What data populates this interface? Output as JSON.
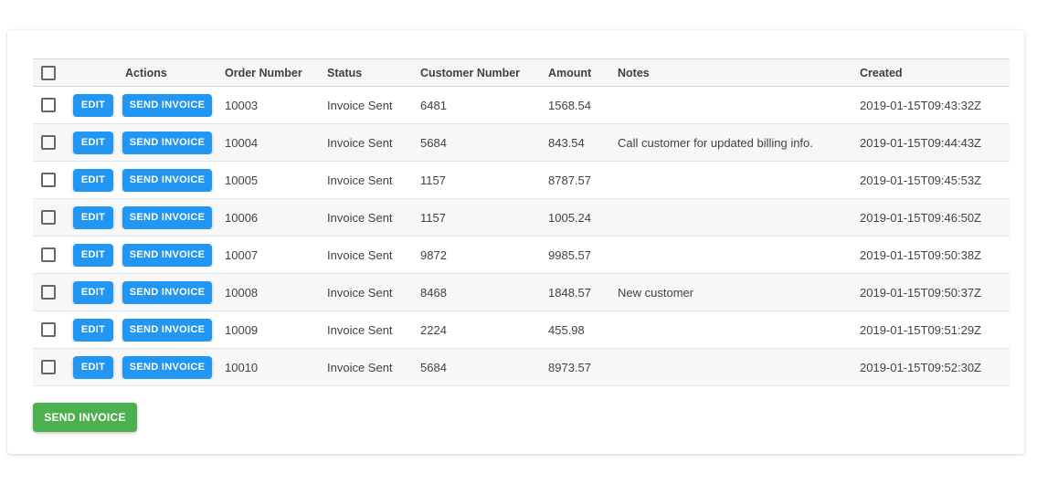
{
  "colors": {
    "action_button_blue": "#2196f3",
    "bulk_button_green": "#4caf50",
    "stripe_gray": "#f7f7f7",
    "header_gray": "#f6f6f6",
    "border_gray": "#e4e4e4"
  },
  "table": {
    "columns": {
      "actions": "Actions",
      "order_number": "Order Number",
      "status": "Status",
      "customer_number": "Customer Number",
      "amount": "Amount",
      "notes": "Notes",
      "created": "Created"
    },
    "action_buttons": {
      "edit": "EDIT",
      "send_invoice": "SEND INVOICE"
    },
    "rows": [
      {
        "order_number": "10003",
        "status": "Invoice Sent",
        "customer_number": "6481",
        "amount": "1568.54",
        "notes": "",
        "created": "2019-01-15T09:43:32Z"
      },
      {
        "order_number": "10004",
        "status": "Invoice Sent",
        "customer_number": "5684",
        "amount": "843.54",
        "notes": "Call customer for updated billing info.",
        "created": "2019-01-15T09:44:43Z"
      },
      {
        "order_number": "10005",
        "status": "Invoice Sent",
        "customer_number": "1157",
        "amount": "8787.57",
        "notes": "",
        "created": "2019-01-15T09:45:53Z"
      },
      {
        "order_number": "10006",
        "status": "Invoice Sent",
        "customer_number": "1157",
        "amount": "1005.24",
        "notes": "",
        "created": "2019-01-15T09:46:50Z"
      },
      {
        "order_number": "10007",
        "status": "Invoice Sent",
        "customer_number": "9872",
        "amount": "9985.57",
        "notes": "",
        "created": "2019-01-15T09:50:38Z"
      },
      {
        "order_number": "10008",
        "status": "Invoice Sent",
        "customer_number": "8468",
        "amount": "1848.57",
        "notes": "New customer",
        "created": "2019-01-15T09:50:37Z"
      },
      {
        "order_number": "10009",
        "status": "Invoice Sent",
        "customer_number": "2224",
        "amount": "455.98",
        "notes": "",
        "created": "2019-01-15T09:51:29Z"
      },
      {
        "order_number": "10010",
        "status": "Invoice Sent",
        "customer_number": "5684",
        "amount": "8973.57",
        "notes": "",
        "created": "2019-01-15T09:52:30Z"
      }
    ]
  },
  "footer": {
    "send_invoice_label": "SEND INVOICE"
  }
}
